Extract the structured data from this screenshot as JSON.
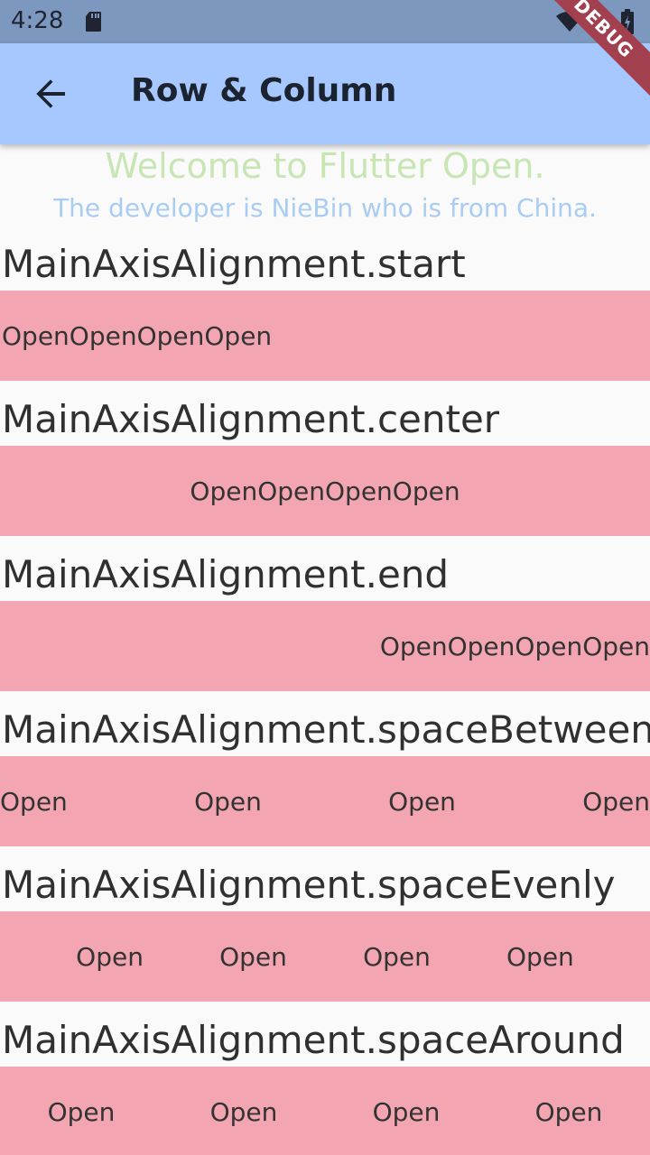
{
  "status_bar": {
    "time": "4:28"
  },
  "app_bar": {
    "title": "Row & Column",
    "debug_banner": "DEBUG"
  },
  "header": {
    "welcome": "Welcome to Flutter Open.",
    "developer": "The developer is NieBin who is from China."
  },
  "sections": [
    {
      "title": "MainAxisAlignment.start",
      "items": [
        "Open",
        "Open",
        "Open",
        "Open"
      ]
    },
    {
      "title": "MainAxisAlignment.center",
      "items": [
        "Open",
        "Open",
        "Open",
        "Open"
      ]
    },
    {
      "title": "MainAxisAlignment.end",
      "items": [
        "Open",
        "Open",
        "Open",
        "Open"
      ]
    },
    {
      "title": "MainAxisAlignment.spaceBetween",
      "items": [
        "Open",
        "Open",
        "Open",
        "Open"
      ]
    },
    {
      "title": "MainAxisAlignment.spaceEvenly",
      "items": [
        "Open",
        "Open",
        "Open",
        "Open"
      ]
    },
    {
      "title": "MainAxisAlignment.spaceAround",
      "items": [
        "Open",
        "Open",
        "Open",
        "Open"
      ]
    }
  ],
  "colors": {
    "status_bar": "#7c98bf",
    "app_bar": "#a6c8ff",
    "row_background": "#f3a6b1",
    "welcome_text": "#c7e6b4",
    "developer_text": "#a9cdf2",
    "debug_ribbon": "#a2404f"
  },
  "icons": {
    "status_sd": "sd-card-icon",
    "status_wifi": "wifi-icon",
    "status_signal": "signal-icon",
    "status_battery": "battery-icon",
    "back": "arrow-back-icon"
  }
}
